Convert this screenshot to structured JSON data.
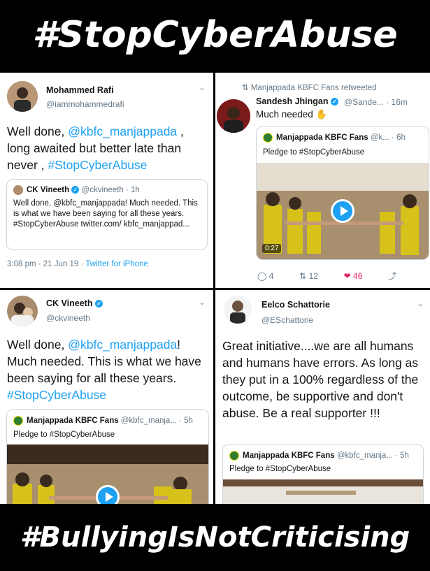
{
  "banners": {
    "top": "#StopCyberAbuse",
    "bottom": "#BullyingIsNotCriticising"
  },
  "tweet1": {
    "name": "Mohammed Rafi",
    "handle": "@iammohammedrafi",
    "text_pre": "Well done, ",
    "mention": "@kbfc_manjappada",
    "text_mid": " , long awaited but better late than never , ",
    "hashtag": "#StopCyberAbuse",
    "quote": {
      "name": "CK Vineeth",
      "handle": "@ckvineeth · 1h",
      "text": "Well done, @kbfc_manjappada! Much needed. This is what we have been saying for all these years. #StopCyberAbuse twitter.com/ kbfc_manjappad..."
    },
    "meta_time": "3:08 pm · 21 Jun 19 · ",
    "meta_source": "Twitter for iPhone"
  },
  "tweet2": {
    "retweet_label": "Manjappada KBFC Fans retweeted",
    "name": "Sandesh Jhingan",
    "handle": "@Sande... · 16m",
    "text": "Much needed",
    "quote": {
      "name": "Manjappada KBFC Fans",
      "handle": "@k... · 6h",
      "text": "Pledge to #StopCyberAbuse",
      "video_time": "0:27"
    },
    "actions": {
      "replies": "4",
      "retweets": "12",
      "likes": "46"
    }
  },
  "tweet3": {
    "name": "CK Vineeth",
    "handle": "@ckvineeth",
    "text_pre": "Well done, ",
    "mention": "@kbfc_manjappada",
    "text_mid": "! Much needed. This is what we have been saying for all these years. ",
    "hashtag": "#StopCyberAbuse",
    "quote": {
      "name": "Manjappada KBFC Fans",
      "handle": "@kbfc_manja... · 5h",
      "text": "Pledge to #StopCyberAbuse"
    }
  },
  "tweet4": {
    "name": "Eelco Schattorie",
    "handle": "@ESchattorie",
    "text": "Great initiative....we are all humans and humans have errors. As long as they put in a 100% regardless of the outcome, be supportive and don't abuse. Be a real supporter !!!",
    "quote": {
      "name": "Manjappada KBFC Fans",
      "handle": "@kbfc_manja... · 5h",
      "text": "Pledge to #StopCyberAbuse"
    }
  },
  "colors": {
    "link": "#1da1f2",
    "like": "#e0245e",
    "muted": "#657786"
  },
  "icons": [
    "chevron-down-icon",
    "verified-badge-icon",
    "retweet-icon",
    "reply-icon",
    "like-icon",
    "share-icon",
    "play-icon"
  ]
}
